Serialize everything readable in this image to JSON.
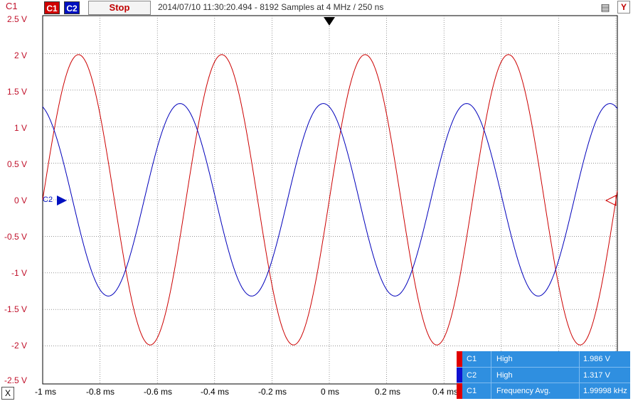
{
  "toolbar": {
    "channel_label": "C1",
    "c1_button": "C1",
    "c2_button": "C2",
    "stop_label": "Stop",
    "status": "2014/07/10  11:30:20.494 - 8192 Samples at 4 MHz / 250 ns",
    "y_button": "Y",
    "x_button": "X"
  },
  "colors": {
    "c1": "#cc0000",
    "c2": "#0000bb",
    "panel": "#2f8fe0"
  },
  "axis": {
    "y_labels": [
      "2.5 V",
      "2 V",
      "1.5 V",
      "1 V",
      "0.5 V",
      "0 V",
      "-0.5 V",
      "-1 V",
      "-1.5 V",
      "-2 V",
      "-2.5 V"
    ],
    "x_labels": [
      "-1 ms",
      "-0.8 ms",
      "-0.6 ms",
      "-0.4 ms",
      "-0.2 ms",
      "0 ms",
      "0.2 ms",
      "0.4 ms"
    ],
    "c2_marker": "C2"
  },
  "waveforms": {
    "c1": {
      "amplitude_v": 1.986,
      "frequency_khz": 1.99998,
      "phase_deg": 0
    },
    "c2": {
      "amplitude_v": 1.317,
      "frequency_khz": 1.99998,
      "phase_deg": 105
    }
  },
  "measurements": [
    {
      "channel": "C1",
      "name": "High",
      "value": "1.986 V",
      "bar_color": "#e00000"
    },
    {
      "channel": "C2",
      "name": "High",
      "value": "1.317 V",
      "bar_color": "#1010d0"
    },
    {
      "channel": "C1",
      "name": "Frequency Avg.",
      "value": "1.99998 kHz",
      "bar_color": "#e00000"
    }
  ]
}
